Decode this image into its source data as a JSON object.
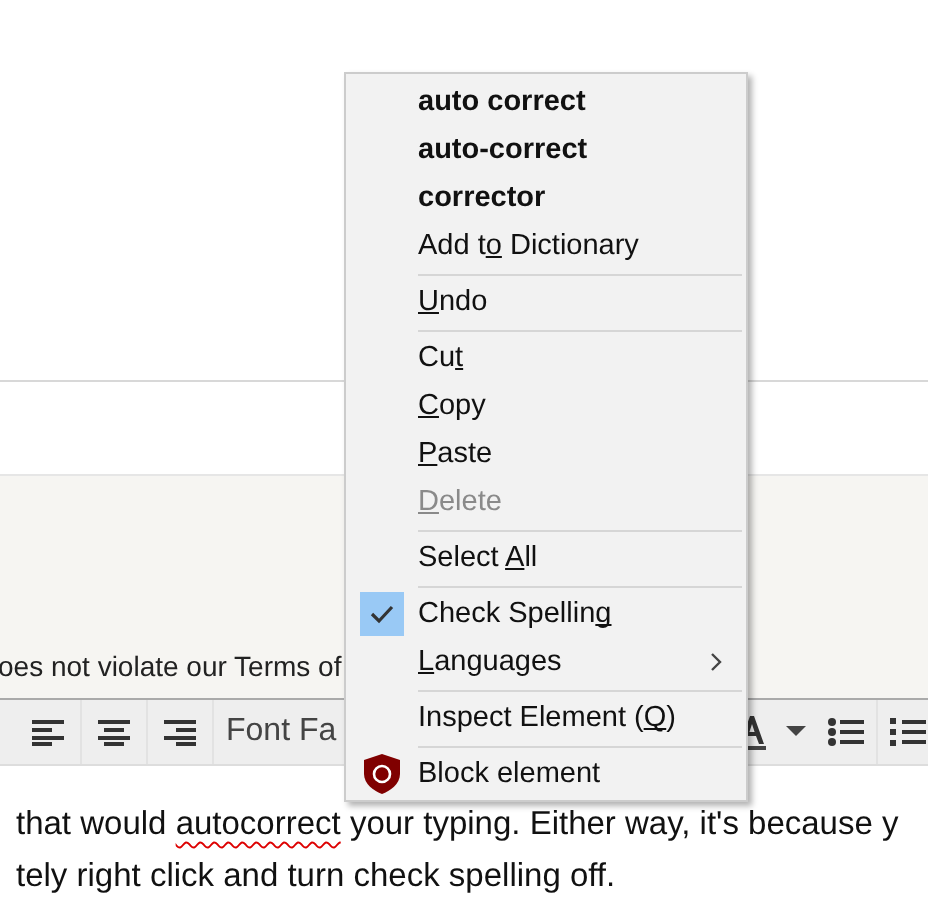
{
  "notice": {
    "text": "oes not violate our Terms of"
  },
  "toolbar": {
    "left": [
      {
        "kind": "align-left"
      },
      {
        "kind": "align-center"
      },
      {
        "kind": "align-right"
      }
    ],
    "font_family": "Font Fa",
    "right": [
      {
        "kind": "text-color"
      },
      {
        "kind": "caret"
      },
      {
        "kind": "bullet-list"
      },
      {
        "kind": "numbered-list"
      }
    ]
  },
  "body": {
    "lines": [
      {
        "parts": [
          {
            "text": "that would ",
            "misspelled": false
          },
          {
            "text": "autocorrect",
            "misspelled": true
          },
          {
            "text": " your typing. Either way, it's because y",
            "misspelled": false
          }
        ]
      },
      {
        "parts": [
          {
            "text": "tely right click and turn check spelling off.",
            "misspelled": false
          }
        ]
      }
    ]
  },
  "context_menu": {
    "items": [
      {
        "kind": "suggestion",
        "label": [
          {
            "text": "auto correct",
            "underlined": false
          }
        ],
        "disabled": false
      },
      {
        "kind": "suggestion",
        "label": [
          {
            "text": "auto-correct",
            "underlined": false
          }
        ],
        "disabled": false
      },
      {
        "kind": "suggestion",
        "label": [
          {
            "text": "corrector",
            "underlined": false
          }
        ],
        "disabled": false
      },
      {
        "kind": "command",
        "label": [
          {
            "text": "Add t",
            "underlined": false
          },
          {
            "text": "o",
            "underlined": true
          },
          {
            "text": " Dictionary",
            "underlined": false
          }
        ],
        "disabled": false
      },
      {
        "kind": "separator"
      },
      {
        "kind": "command",
        "label": [
          {
            "text": "U",
            "underlined": true
          },
          {
            "text": "ndo",
            "underlined": false
          }
        ],
        "disabled": false
      },
      {
        "kind": "separator"
      },
      {
        "kind": "command",
        "label": [
          {
            "text": "Cu",
            "underlined": false
          },
          {
            "text": "t",
            "underlined": true
          }
        ],
        "disabled": false
      },
      {
        "kind": "command",
        "label": [
          {
            "text": "C",
            "underlined": true
          },
          {
            "text": "opy",
            "underlined": false
          }
        ],
        "disabled": false
      },
      {
        "kind": "command",
        "label": [
          {
            "text": "P",
            "underlined": true
          },
          {
            "text": "aste",
            "underlined": false
          }
        ],
        "disabled": false
      },
      {
        "kind": "command",
        "label": [
          {
            "text": "D",
            "underlined": true
          },
          {
            "text": "elete",
            "underlined": false
          }
        ],
        "disabled": true
      },
      {
        "kind": "separator"
      },
      {
        "kind": "command",
        "label": [
          {
            "text": "Select ",
            "underlined": false
          },
          {
            "text": "A",
            "underlined": true
          },
          {
            "text": "ll",
            "underlined": false
          }
        ],
        "disabled": false
      },
      {
        "kind": "separator"
      },
      {
        "kind": "checkbox",
        "label": [
          {
            "text": "Check Spellin",
            "underlined": false
          },
          {
            "text": "g",
            "underlined": true
          }
        ],
        "disabled": false,
        "checked": true
      },
      {
        "kind": "submenu",
        "label": [
          {
            "text": "L",
            "underlined": true
          },
          {
            "text": "anguages",
            "underlined": false
          }
        ],
        "disabled": false
      },
      {
        "kind": "separator"
      },
      {
        "kind": "command",
        "label": [
          {
            "text": "Inspect Element (",
            "underlined": false
          },
          {
            "text": "Q",
            "underlined": true
          },
          {
            "text": ")",
            "underlined": false
          }
        ],
        "disabled": false
      },
      {
        "kind": "separator"
      },
      {
        "kind": "extension",
        "label": [
          {
            "text": "Block element",
            "underlined": false
          }
        ],
        "disabled": false
      }
    ]
  }
}
